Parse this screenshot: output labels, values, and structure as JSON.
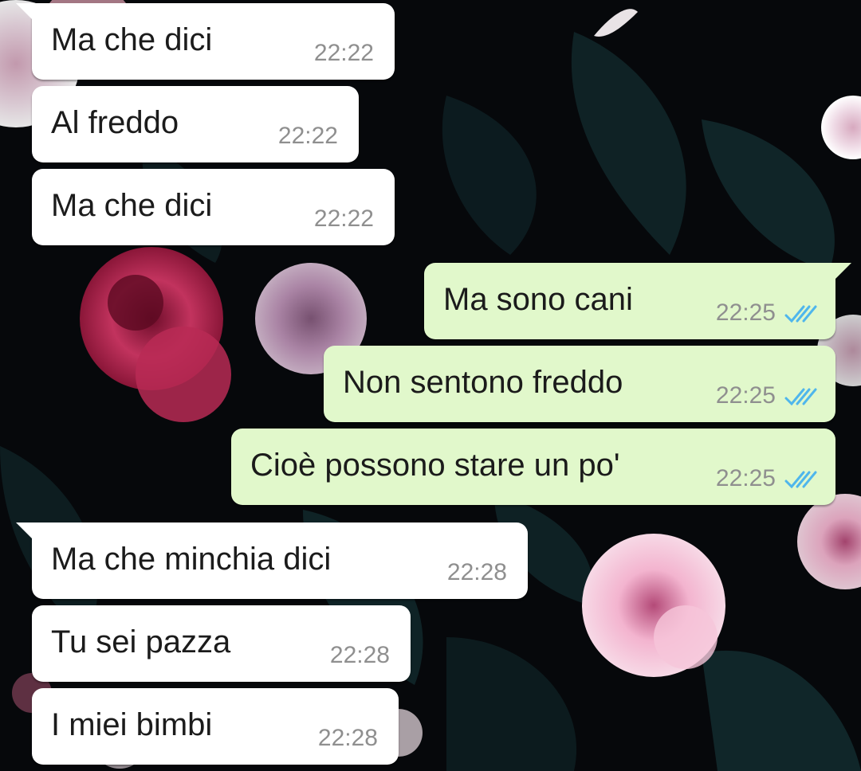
{
  "colors": {
    "incoming_bubble": "#ffffff",
    "outgoing_bubble": "#e1f8cb",
    "timestamp": "#8f8f8f",
    "read_ticks": "#4fb6ec",
    "background": "#06080b"
  },
  "messages": [
    {
      "direction": "incoming",
      "text": "Ma che dici",
      "time": "22:22"
    },
    {
      "direction": "incoming",
      "text": "Al freddo",
      "time": "22:22"
    },
    {
      "direction": "incoming",
      "text": "Ma che dici",
      "time": "22:22"
    },
    {
      "direction": "outgoing",
      "text": "Ma sono cani",
      "time": "22:25",
      "status_icon": "double-check-read-icon"
    },
    {
      "direction": "outgoing",
      "text": "Non sentono freddo",
      "time": "22:25",
      "status_icon": "double-check-read-icon"
    },
    {
      "direction": "outgoing",
      "text": "Cioè possono stare un po'",
      "time": "22:25",
      "status_icon": "double-check-read-icon"
    },
    {
      "direction": "incoming",
      "text": "Ma che minchia dici",
      "time": "22:28"
    },
    {
      "direction": "incoming",
      "text": "Tu sei pazza",
      "time": "22:28"
    },
    {
      "direction": "incoming",
      "text": "I miei bimbi",
      "time": "22:28"
    }
  ],
  "wallpaper": "dark floral"
}
